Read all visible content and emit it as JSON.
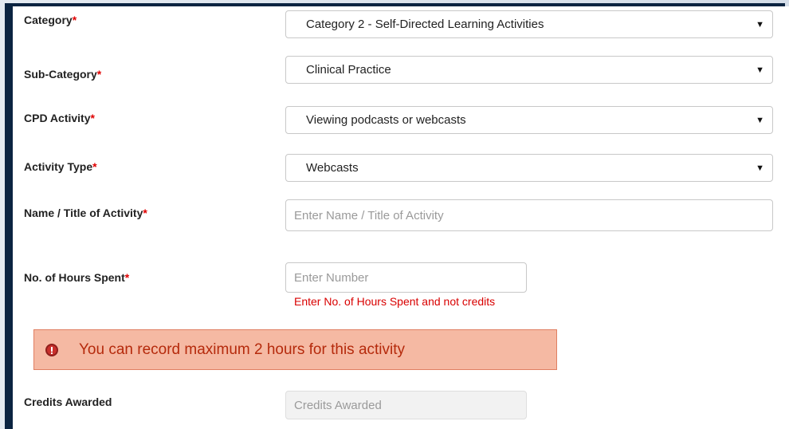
{
  "form": {
    "category": {
      "label": "Category",
      "required_mark": "*",
      "value": "Category 2 - Self-Directed Learning Activities"
    },
    "sub_category": {
      "label": "Sub-Category",
      "required_mark": "*",
      "value": "Clinical Practice"
    },
    "cpd_activity": {
      "label": "CPD Activity",
      "required_mark": "*",
      "value": "Viewing podcasts or webcasts"
    },
    "activity_type": {
      "label": "Activity Type",
      "required_mark": "*",
      "value": "Webcasts"
    },
    "activity_name": {
      "label": "Name / Title of Activity",
      "required_mark": "*",
      "placeholder": "Enter Name / Title of Activity"
    },
    "hours_spent": {
      "label": "No. of Hours Spent",
      "required_mark": "*",
      "placeholder": "Enter Number",
      "hint": "Enter No. of Hours Spent and not credits"
    },
    "alert": {
      "message": "You can record maximum 2 hours for this activity"
    },
    "credits_awarded": {
      "label": "Credits Awarded",
      "placeholder": "Credits Awarded"
    }
  },
  "dropdown_caret": "▼",
  "colors": {
    "required": "#e00000",
    "hint": "#d90000",
    "alert_bg": "#f5b9a3",
    "alert_text": "#b52a0c",
    "frame": "#0b2441"
  }
}
